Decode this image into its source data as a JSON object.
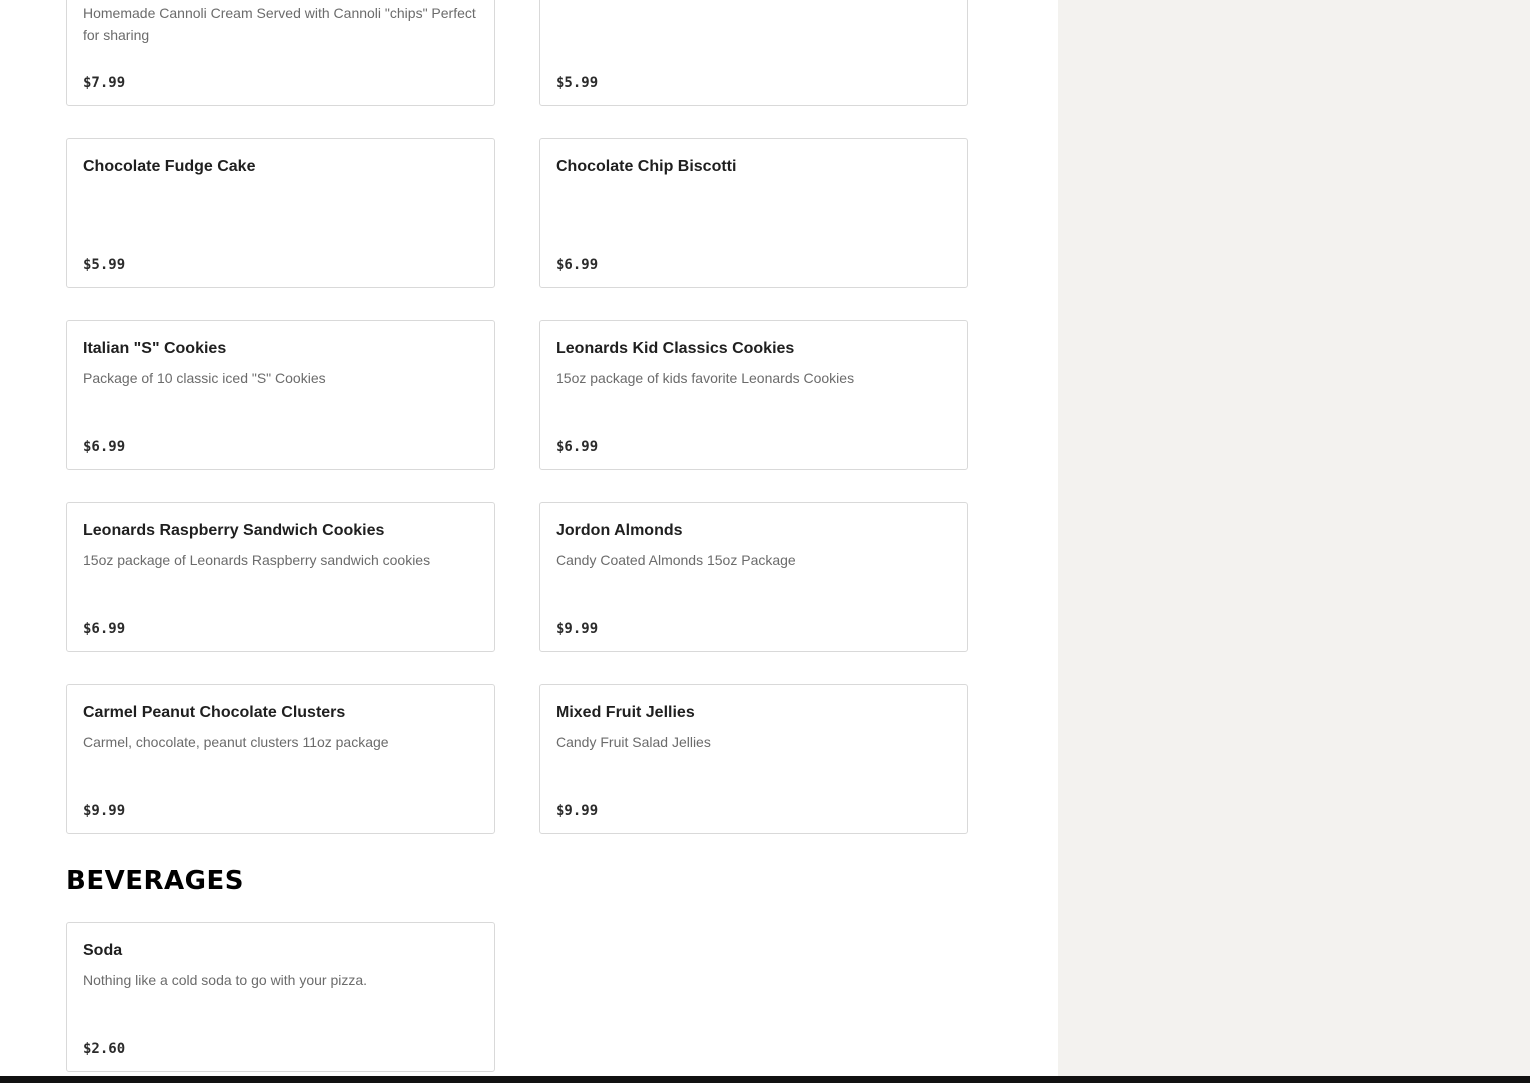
{
  "desserts": {
    "items": [
      {
        "name": "",
        "description": "Homemade Cannoli Cream Served with Cannoli \"chips\" Perfect for sharing",
        "price": "$7.99"
      },
      {
        "name": "",
        "description": "",
        "price": "$5.99"
      },
      {
        "name": "Chocolate Fudge Cake",
        "description": "",
        "price": "$5.99"
      },
      {
        "name": "Chocolate Chip Biscotti",
        "description": "",
        "price": "$6.99"
      },
      {
        "name": "Italian \"S\" Cookies",
        "description": "Package of 10 classic iced \"S\" Cookies",
        "price": "$6.99"
      },
      {
        "name": "Leonards Kid Classics Cookies",
        "description": "15oz package of kids favorite Leonards Cookies",
        "price": "$6.99"
      },
      {
        "name": "Leonards Raspberry Sandwich Cookies",
        "description": "15oz package of Leonards Raspberry sandwich cookies",
        "price": "$6.99"
      },
      {
        "name": "Jordon Almonds",
        "description": "Candy Coated Almonds 15oz Package",
        "price": "$9.99"
      },
      {
        "name": "Carmel Peanut Chocolate Clusters",
        "description": "Carmel, chocolate, peanut clusters 11oz package",
        "price": "$9.99"
      },
      {
        "name": "Mixed Fruit Jellies",
        "description": "Candy Fruit Salad Jellies",
        "price": "$9.99"
      }
    ]
  },
  "beverages": {
    "title": "BEVERAGES",
    "items": [
      {
        "name": "Soda",
        "description": "Nothing like a cold soda to go with your pizza.",
        "price": "$2.60"
      }
    ]
  },
  "colors": {
    "side_panel": "#f3f2ef",
    "card_border": "#d9d9d9",
    "bottom_bar": "#111111"
  }
}
